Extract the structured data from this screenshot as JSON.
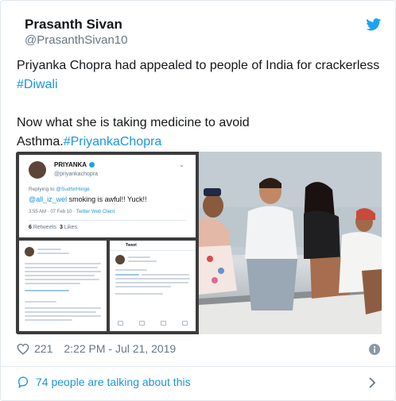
{
  "tweet": {
    "display_name": "Prasanth Sivan",
    "handle": "@PrasanthSivan10",
    "text_line1": "Priyanka Chopra had appealed to people of India for crackerless ",
    "hashtag_diwali": "#Diwali",
    "text_line2": "Now what she is taking medicine to avoid",
    "text_line3": "Asthma.",
    "hashtag_pc": "#PriyankaChopra",
    "likes": "221",
    "timestamp": "2:22 PM - Jul 21, 2019",
    "talking": "74 people are talking about this"
  },
  "embedded": {
    "name": "PRIYANKA",
    "handle": "@priyankachopra",
    "replying_label": "Replying to ",
    "replying_handle": "@SudhirHinge",
    "mention": "@all_iz_wel",
    "body": " smoking is awful!! Yuck!!",
    "time": "3:55 AM · 07 Feb 10 · ",
    "client": "Twitter Web Client",
    "retweets_num": "6",
    "retweets_label": "Retweets",
    "likes_num": "3",
    "likes_label": "Likes",
    "tweet_header": "Tweet"
  },
  "colors": {
    "link": "#1b95e0",
    "muted": "#657786",
    "border": "#e1e8ed",
    "twitter_blue": "#1da1f2"
  },
  "icons": [
    "twitter-bird-icon",
    "heart-icon",
    "info-icon",
    "speech-bubble-icon",
    "chevron-right-icon"
  ]
}
